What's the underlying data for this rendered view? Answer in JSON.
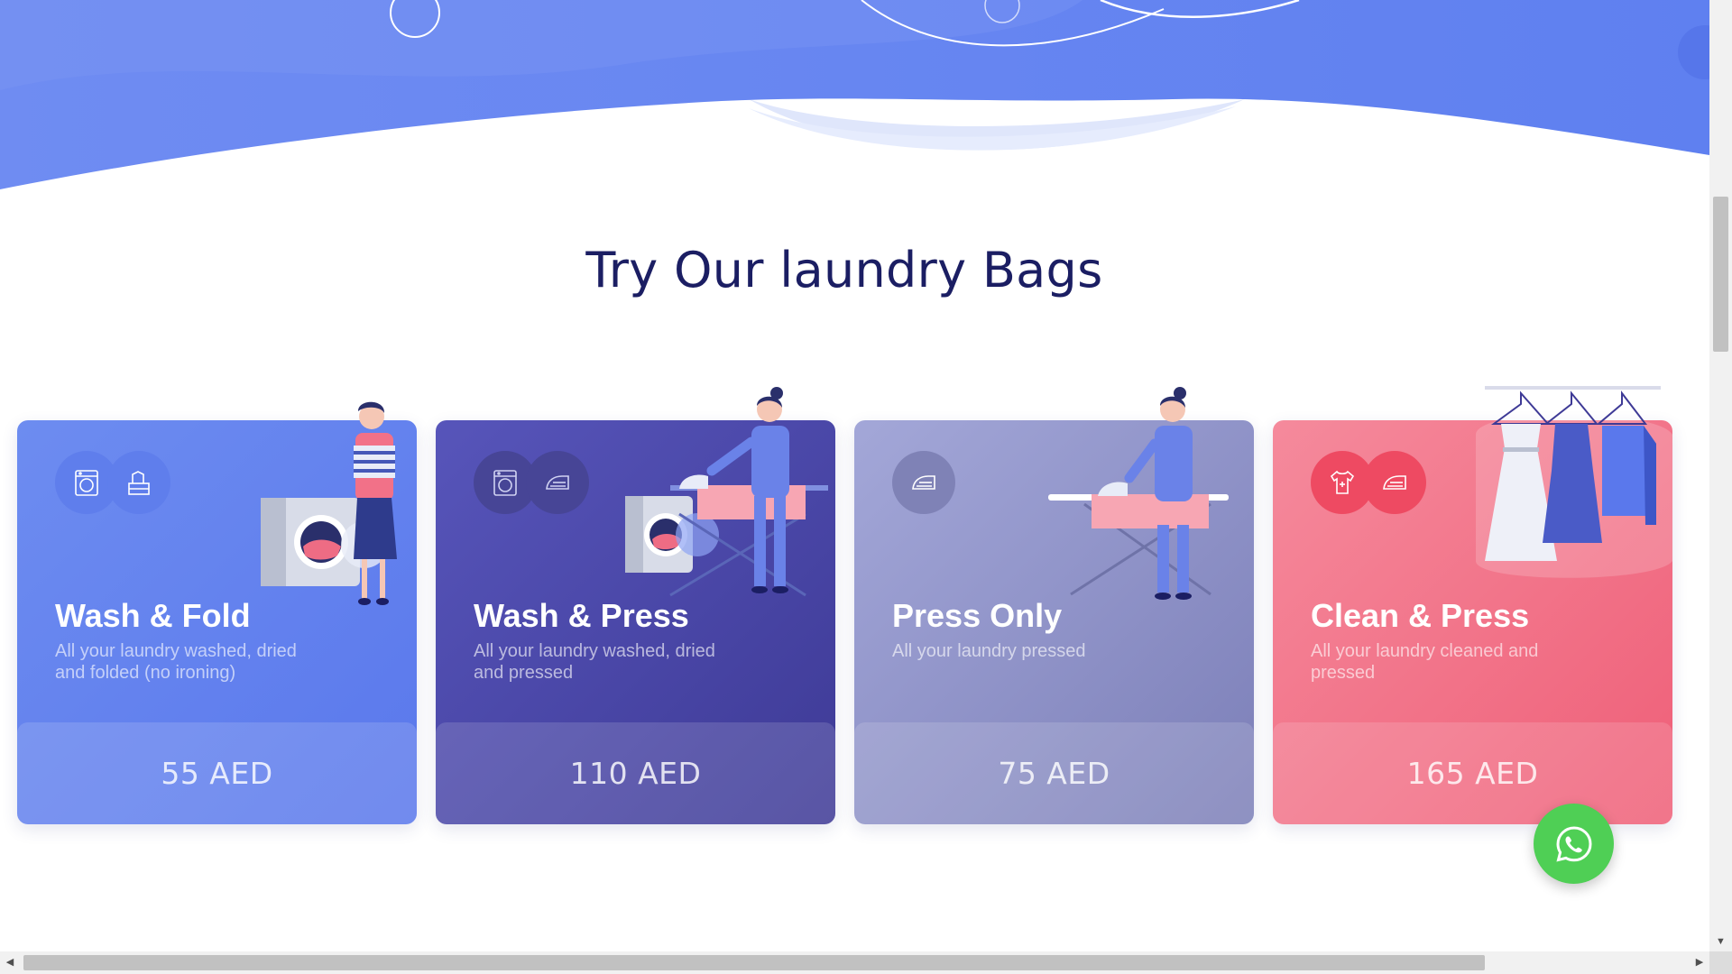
{
  "section": {
    "title": "Try Our laundry Bags"
  },
  "cards": [
    {
      "title": "Wash & Fold",
      "description": "All your laundry washed, dried and folded (no ironing)",
      "price": "55 AED",
      "icons": [
        "washing-machine-icon",
        "folded-clothes-icon"
      ]
    },
    {
      "title": "Wash & Press",
      "description": "All your laundry washed, dried and pressed",
      "price": "110 AED",
      "icons": [
        "washing-machine-icon",
        "iron-icon"
      ]
    },
    {
      "title": "Press Only",
      "description": "All your laundry  pressed",
      "price": "75 AED",
      "icons": [
        "iron-icon"
      ]
    },
    {
      "title": "Clean & Press",
      "description": "All your laundry cleaned and pressed",
      "price": "165 AED",
      "icons": [
        "shirt-icon",
        "iron-icon"
      ]
    }
  ],
  "colors": {
    "title": "#1b1e63",
    "hero_blue": "#6585f0",
    "card_wash_fold": "#6d8cf0",
    "card_wash_press": "#4a47a8",
    "card_press_only": "#9094c9",
    "card_clean_press": "#f27188",
    "whatsapp_green": "#4fcf55"
  },
  "whatsapp": {
    "icon": "whatsapp-icon"
  },
  "scrollbars": {
    "vertical": true,
    "horizontal": true
  }
}
